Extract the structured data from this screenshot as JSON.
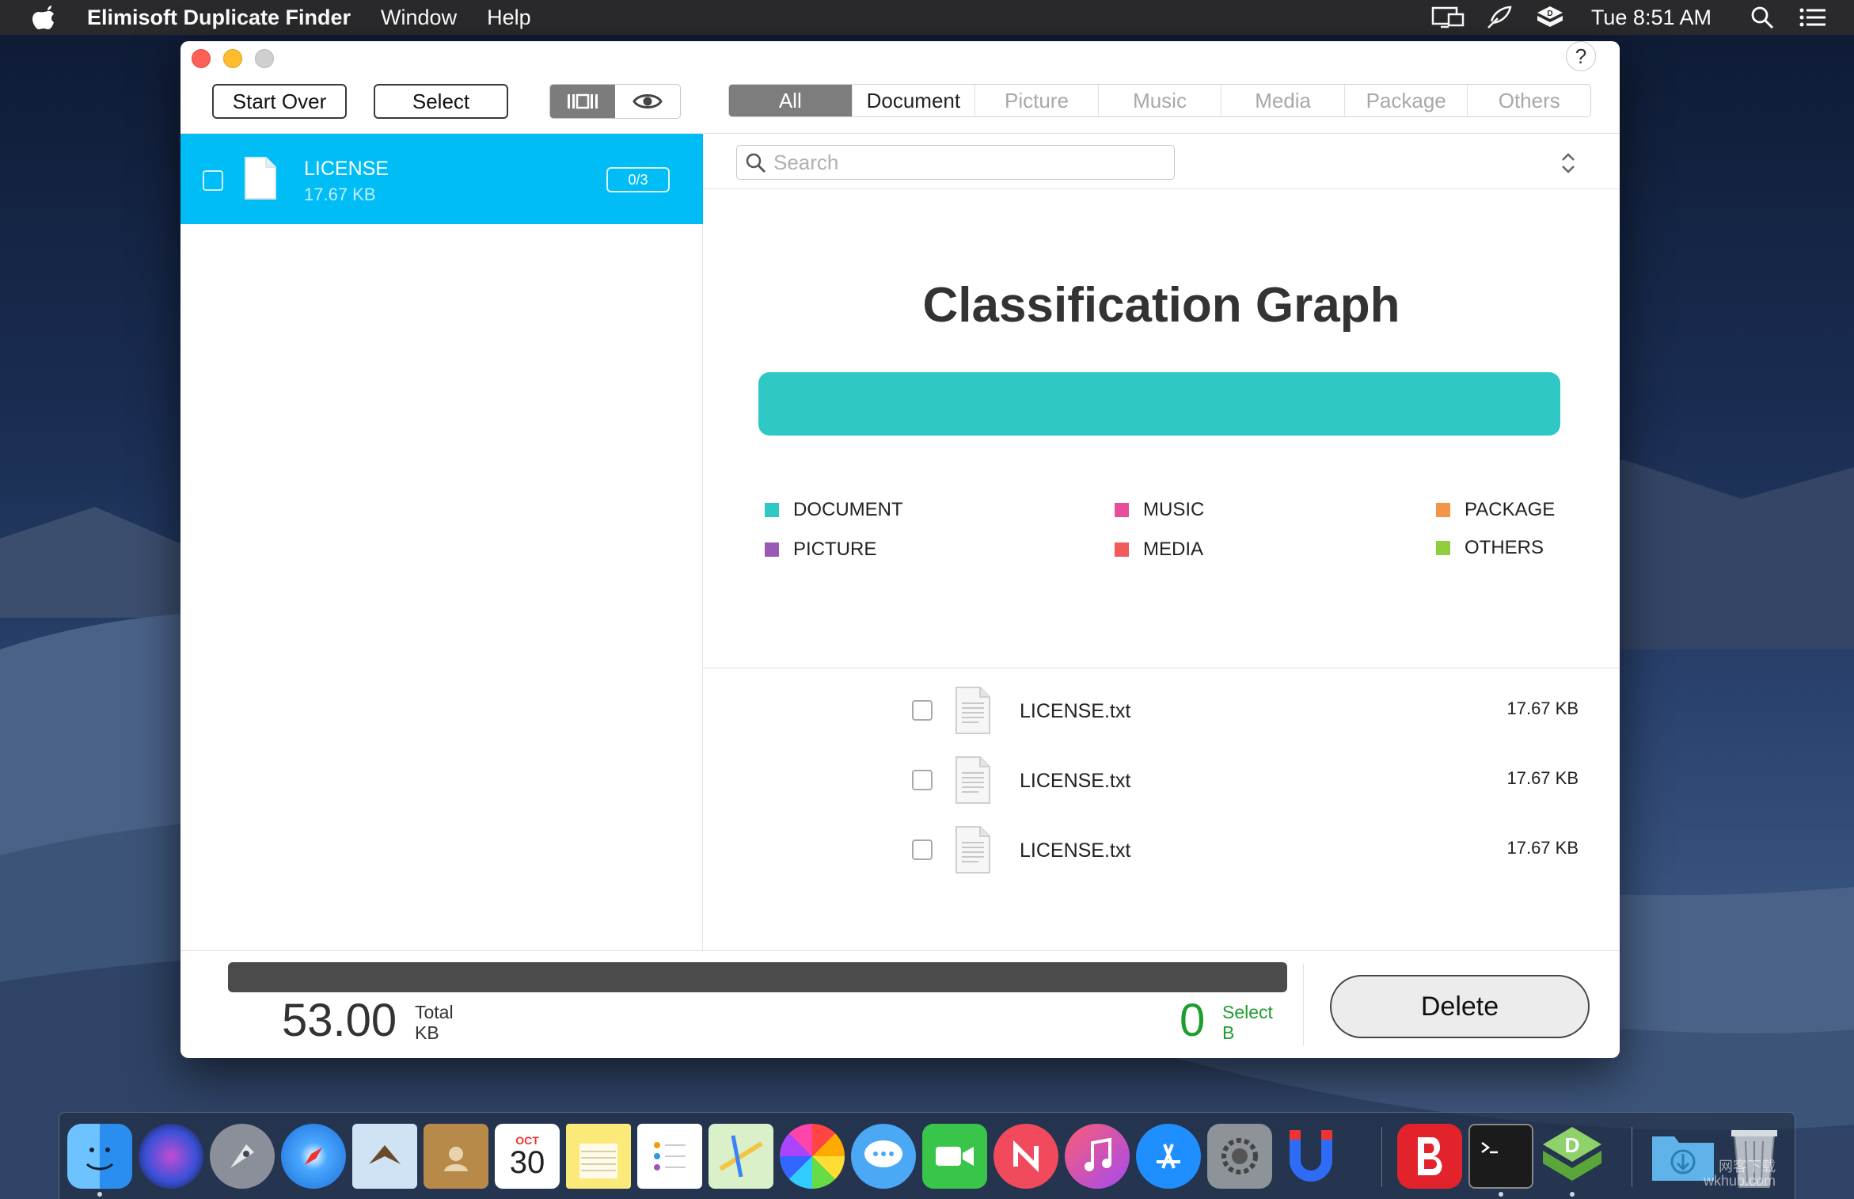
{
  "menubar": {
    "app_name": "Elimisoft Duplicate Finder",
    "menus": [
      "Window",
      "Help"
    ],
    "clock": "Tue 8:51 AM"
  },
  "toolbar": {
    "start_over_label": "Start Over",
    "select_label": "Select",
    "help_label": "?",
    "view_mode": "list",
    "tabs": [
      {
        "label": "All",
        "active": true
      },
      {
        "label": "Document",
        "active": false
      },
      {
        "label": "Picture",
        "active": false
      },
      {
        "label": "Music",
        "active": false
      },
      {
        "label": "Media",
        "active": false
      },
      {
        "label": "Package",
        "active": false
      },
      {
        "label": "Others",
        "active": false
      }
    ]
  },
  "groups": [
    {
      "name": "LICENSE",
      "size": "17.67 KB",
      "count": "0/3",
      "selected": true
    }
  ],
  "search": {
    "placeholder": "Search",
    "value": ""
  },
  "graph": {
    "title": "Classification Graph",
    "document_fraction": 1.0,
    "legend": [
      {
        "label": "DOCUMENT",
        "color": "#2fc8c4"
      },
      {
        "label": "PICTURE",
        "color": "#9b59b6"
      },
      {
        "label": "MUSIC",
        "color": "#e84c9b"
      },
      {
        "label": "MEDIA",
        "color": "#f25b5b"
      },
      {
        "label": "PACKAGE",
        "color": "#f0954a"
      },
      {
        "label": "OTHERS",
        "color": "#8fce3e"
      }
    ]
  },
  "files": [
    {
      "name": "LICENSE.txt",
      "size": "17.67 KB",
      "checked": false
    },
    {
      "name": "LICENSE.txt",
      "size": "17.67 KB",
      "checked": false
    },
    {
      "name": "LICENSE.txt",
      "size": "17.67 KB",
      "checked": false
    }
  ],
  "summary": {
    "total_value": "53.00",
    "total_label": "Total",
    "total_unit": "KB",
    "select_value": "0",
    "select_label": "Select",
    "select_unit": "B",
    "progress_fraction": 1.0,
    "delete_label": "Delete"
  },
  "dock": {
    "items": [
      "Finder",
      "Siri",
      "Launchpad",
      "Safari",
      "Mail",
      "Contacts",
      "Calendar",
      "Notes",
      "Reminders",
      "Maps",
      "Photos",
      "Messages",
      "FaceTime",
      "News",
      "iTunes",
      "App Store",
      "System Preferences",
      "Magnet",
      "Bartender",
      "Terminal",
      "Duplicate Finder",
      "Downloads",
      "Trash"
    ],
    "calendar_month": "OCT",
    "calendar_day": "30",
    "watermark_line1": "网客下载",
    "watermark_line2": "wkhub.com"
  }
}
